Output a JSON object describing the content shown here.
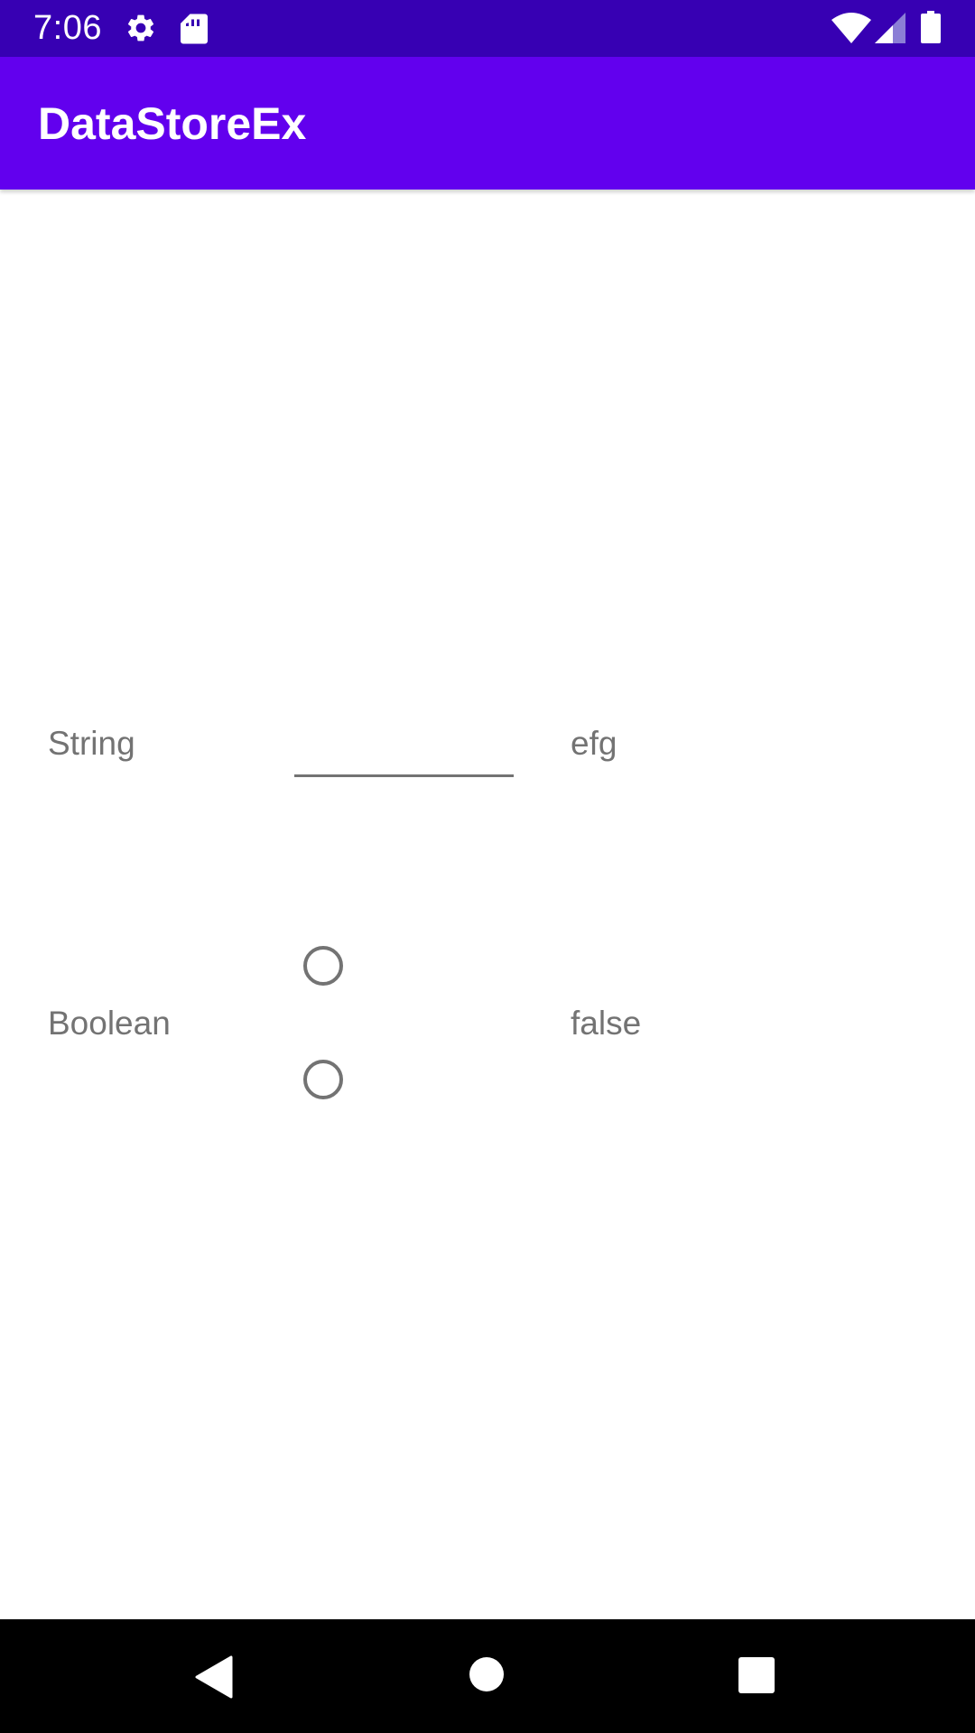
{
  "status_bar": {
    "time": "7:06",
    "icons": [
      "gear-icon",
      "sd-card-icon",
      "wifi-icon",
      "cellular-signal-icon",
      "battery-icon"
    ],
    "background": "#3700b3"
  },
  "app_bar": {
    "title": "DataStoreEx",
    "background": "#6200ee"
  },
  "string_row": {
    "label": "String",
    "input_value": "",
    "stored_value": "efg"
  },
  "boolean_row": {
    "label": "Boolean",
    "options": [
      "",
      ""
    ],
    "selected_index": null,
    "stored_value": "false"
  },
  "nav_bar": {
    "buttons": [
      "back-icon",
      "home-icon",
      "recents-icon"
    ],
    "background": "#000000"
  }
}
